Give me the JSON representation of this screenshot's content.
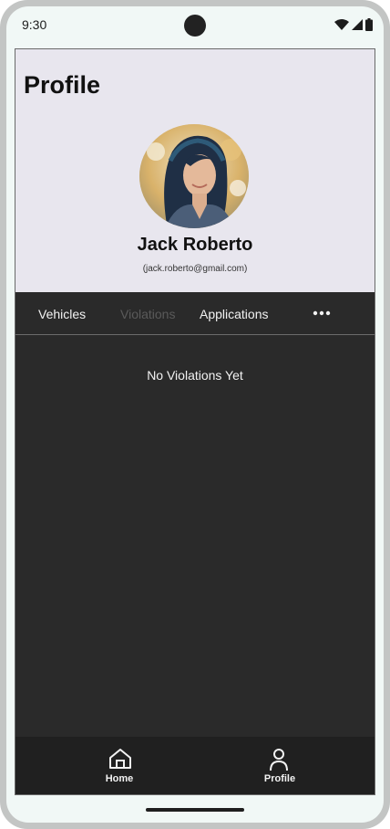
{
  "status_bar": {
    "time": "9:30",
    "icons": [
      "wifi-icon",
      "signal-icon",
      "battery-icon"
    ]
  },
  "profile": {
    "page_title": "Profile",
    "name": "Jack Roberto",
    "email": "(jack.roberto@gmail.com)"
  },
  "tabs": {
    "items": [
      {
        "label": "Vehicles",
        "state": "default"
      },
      {
        "label": "Violations",
        "state": "selected-muted"
      },
      {
        "label": "Applications",
        "state": "default"
      }
    ],
    "more_icon": "more-horizontal-icon"
  },
  "content": {
    "empty_message": "No Violations Yet"
  },
  "bottom_nav": {
    "items": [
      {
        "label": "Home",
        "icon": "home-icon"
      },
      {
        "label": "Profile",
        "icon": "person-icon"
      }
    ]
  },
  "colors": {
    "header_bg": "#e8e6ee",
    "content_bg": "#2a2a2a",
    "nav_bg": "#202020",
    "text_light": "#f2f2f2",
    "tab_muted": "#5a5a5a",
    "frame": "#c3c5c4"
  }
}
